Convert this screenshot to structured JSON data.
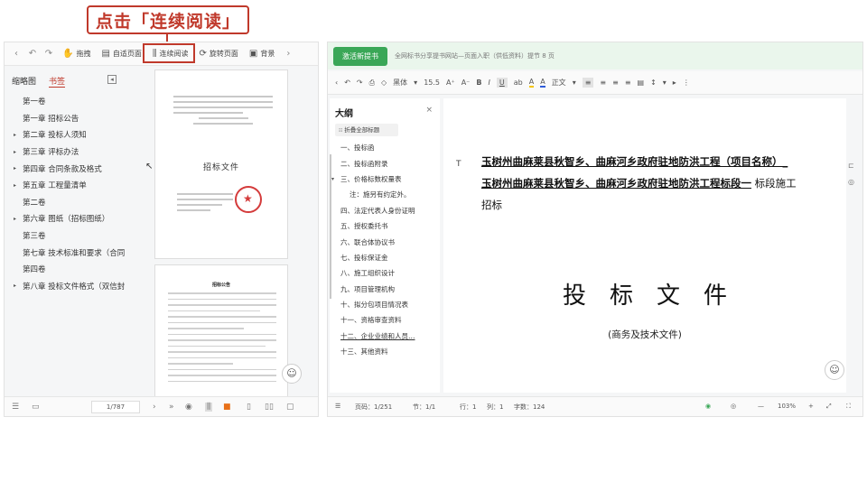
{
  "callout": {
    "text": "点击「连续阅读」"
  },
  "left_toolbar": {
    "nav_icons": [
      "‹",
      "↶",
      "↷"
    ],
    "buttons": [
      {
        "glyph": "✋",
        "label": "拖拽"
      },
      {
        "glyph": "▤",
        "label": "自适页面"
      },
      {
        "glyph": "⫼",
        "label": "连续阅读"
      },
      {
        "glyph": "⟳",
        "label": "旋转页面"
      },
      {
        "glyph": "▣",
        "label": "背景"
      }
    ],
    "more": "›"
  },
  "left_tabs": {
    "thumbnails": "缩略图",
    "bookmarks": "书签"
  },
  "toc": [
    {
      "arrow": "",
      "label": "第一卷"
    },
    {
      "arrow": "",
      "label": "第一章 招标公告"
    },
    {
      "arrow": "▸",
      "label": "第二章 投标人须知"
    },
    {
      "arrow": "▸",
      "label": "第三章 评标办法"
    },
    {
      "arrow": "▸",
      "label": "第四章 合同条款及格式"
    },
    {
      "arrow": "▸",
      "label": "第五章 工程量清单"
    },
    {
      "arrow": "",
      "label": "第二卷"
    },
    {
      "arrow": "▸",
      "label": "第六章 图纸（招标图纸）"
    },
    {
      "arrow": "",
      "label": "第三卷"
    },
    {
      "arrow": "",
      "label": "第七章 技术标准和要求（合同"
    },
    {
      "arrow": "",
      "label": "第四卷"
    },
    {
      "arrow": "▸",
      "label": "第八章 投标文件格式（双信封"
    }
  ],
  "page1": {
    "title": "招标文件"
  },
  "page2": {
    "heading": "招标公告"
  },
  "left_status": {
    "page_indicator": "1/787"
  },
  "right_top": {
    "button": "激活新提书",
    "text": "全网标书分享提书网站—页面入职（供低资料）提节 8 页"
  },
  "right_toolbar": {
    "font": "黑体",
    "size": "15.5",
    "items": [
      "A⁺",
      "A⁻",
      "B",
      "I",
      "U",
      "ab",
      "A",
      "A",
      "正文"
    ]
  },
  "outline": {
    "title": "大纲",
    "close": "×",
    "collapse": "折叠全部标题",
    "items": [
      {
        "arrow": "",
        "label": "一、投标函",
        "sub": false,
        "underline": false
      },
      {
        "arrow": "",
        "label": "二、投标函附录",
        "sub": false,
        "underline": false
      },
      {
        "arrow": "▾",
        "label": "三、价格标数权量表",
        "sub": false,
        "underline": false
      },
      {
        "arrow": "",
        "label": "注：施另有约定外。",
        "sub": true,
        "underline": false
      },
      {
        "arrow": "",
        "label": "四、法定代表人身份证明",
        "sub": false,
        "underline": false
      },
      {
        "arrow": "",
        "label": "五、授权委托书",
        "sub": false,
        "underline": false
      },
      {
        "arrow": "",
        "label": "六、联合体协议书",
        "sub": false,
        "underline": false
      },
      {
        "arrow": "",
        "label": "七、投标保证金",
        "sub": false,
        "underline": false
      },
      {
        "arrow": "",
        "label": "八、施工组织设计",
        "sub": false,
        "underline": false
      },
      {
        "arrow": "",
        "label": "九、项目管理机构",
        "sub": false,
        "underline": false
      },
      {
        "arrow": "",
        "label": "十、拟分包项目情况表",
        "sub": false,
        "underline": false
      },
      {
        "arrow": "",
        "label": "十一、资格审查资料",
        "sub": false,
        "underline": false
      },
      {
        "arrow": "",
        "label": "十二、企业业绩和人员…",
        "sub": false,
        "underline": true
      },
      {
        "arrow": "",
        "label": "十三、其他资料",
        "sub": false,
        "underline": false
      }
    ]
  },
  "document": {
    "t_mark": "T",
    "line1": "玉树州曲麻莱县秋智乡、曲麻河乡政府驻地防洪工程（项目名称）_",
    "line2_underlined": "玉树州曲麻莱县秋智乡、曲麻河乡政府驻地防洪工程标段一",
    "line2_rest": " 标段施工",
    "line3": "招标",
    "title": "投标文件",
    "subtitle": "(商务及技术文件)"
  },
  "right_status": {
    "page": "页码：1/251",
    "section": "节：1/1",
    "row": "行：1",
    "col": "列：1",
    "words": "字数：124",
    "zoom": "103%"
  },
  "colors": {
    "accent_red": "#c0392b",
    "brand_green": "#3aa757"
  }
}
